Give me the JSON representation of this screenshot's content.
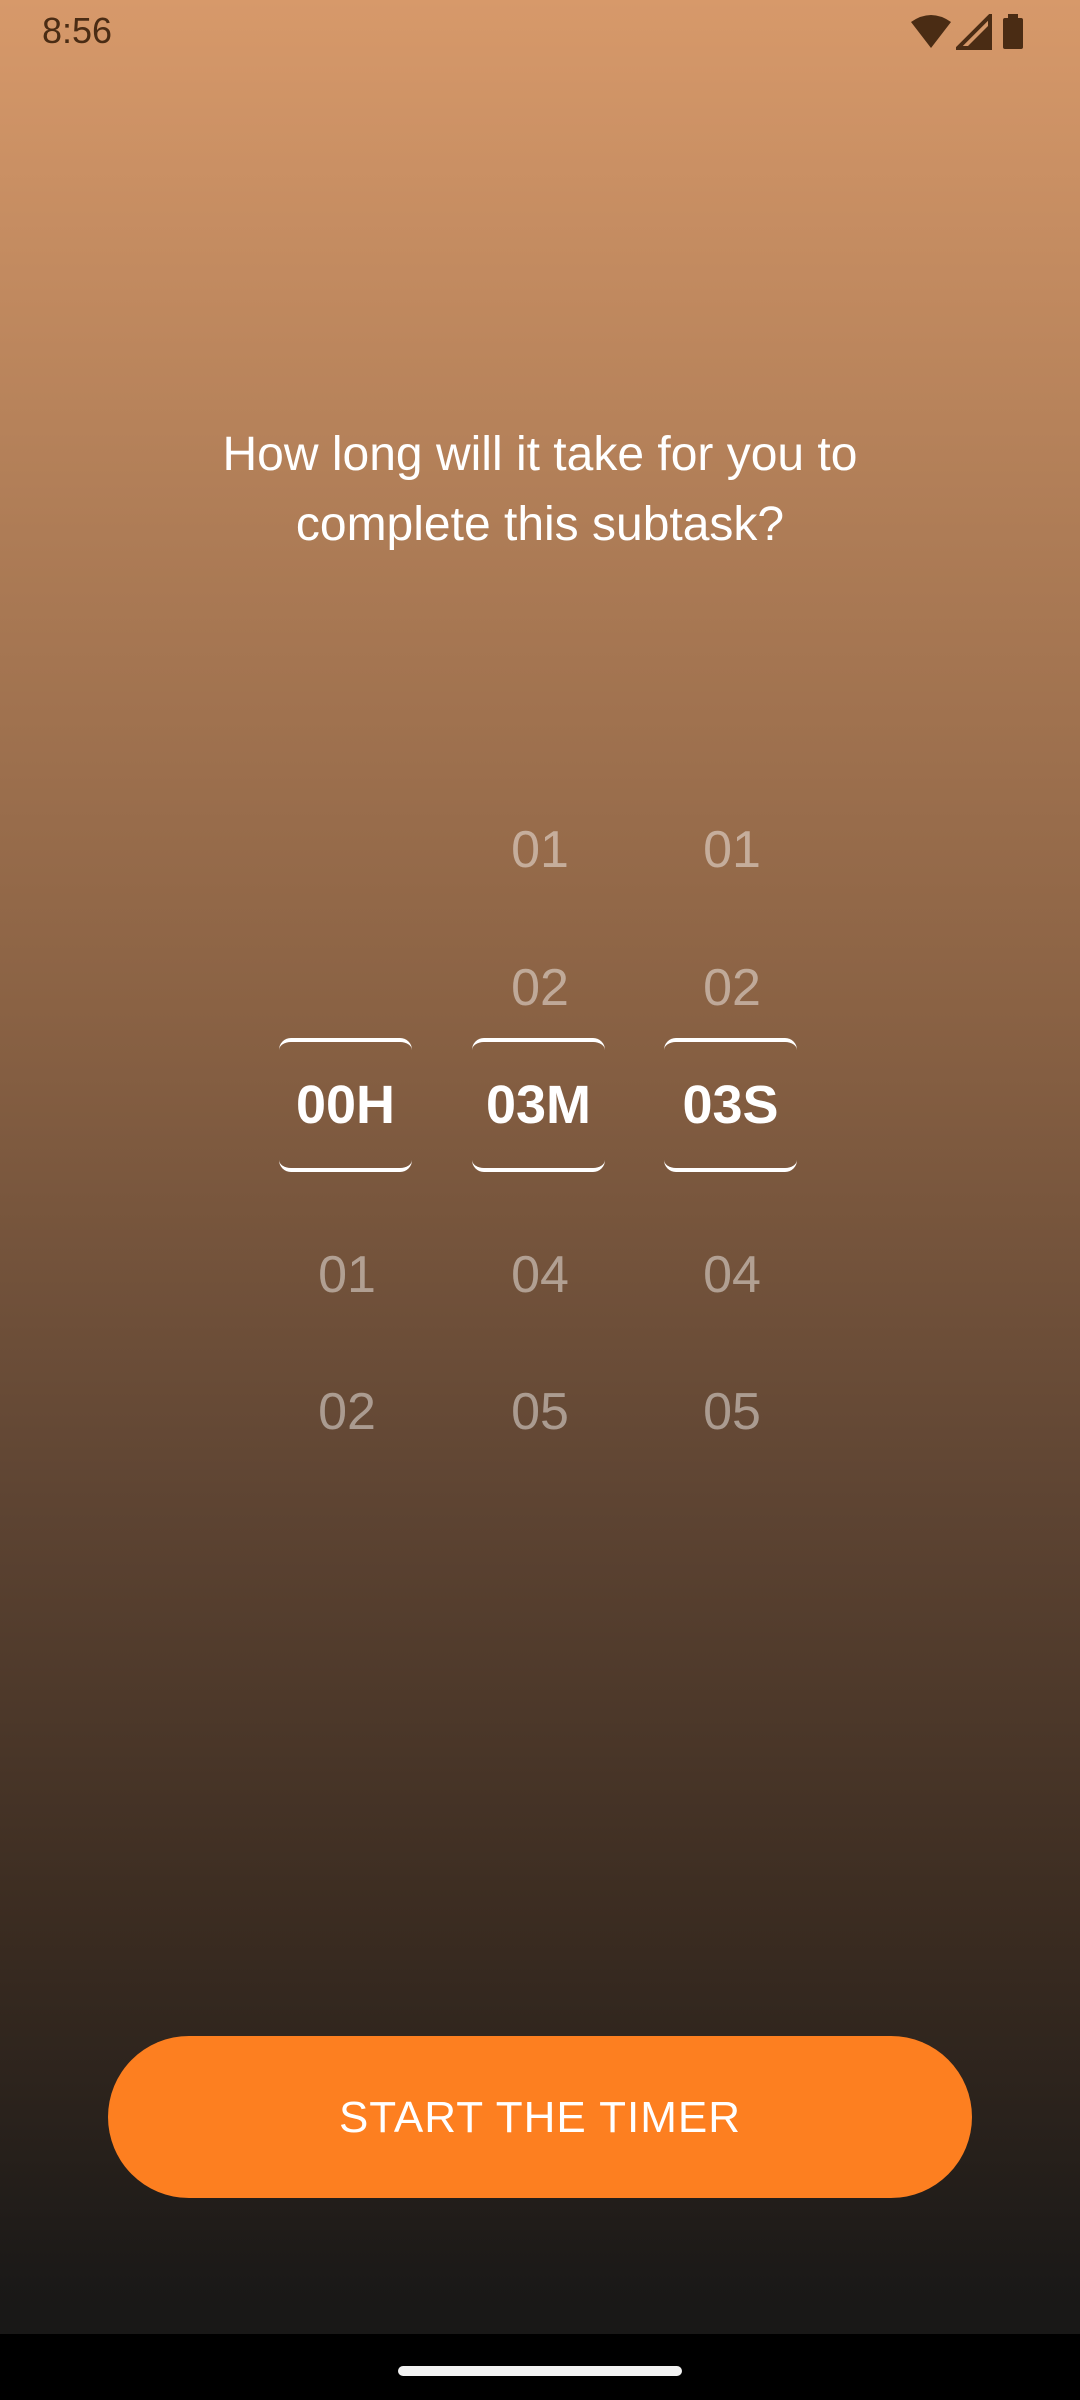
{
  "status_bar": {
    "time": "8:56",
    "icons": [
      "wifi-icon",
      "signal-icon",
      "battery-icon"
    ]
  },
  "question": "How long will it take for you to complete this subtask?",
  "picker": {
    "hours": {
      "above": [
        "",
        ""
      ],
      "selected": "00H",
      "below": [
        "01",
        "02"
      ]
    },
    "minutes": {
      "above": [
        "01",
        "02"
      ],
      "selected": "03M",
      "below": [
        "04",
        "05"
      ]
    },
    "seconds": {
      "above": [
        "01",
        "02"
      ],
      "selected": "03S",
      "below": [
        "04",
        "05"
      ]
    }
  },
  "start_button": "START THE TIMER",
  "colors": {
    "accent": "#fd7f20",
    "gradient_top": "#d7996a",
    "gradient_bottom": "#191817",
    "text": "#ffffff"
  }
}
